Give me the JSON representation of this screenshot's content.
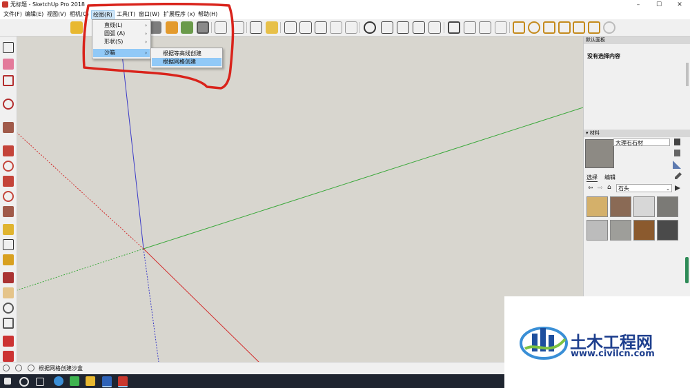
{
  "window": {
    "title": "无标题 - SketchUp Pro 2018",
    "controls": [
      "–",
      "☐",
      "✕"
    ]
  },
  "menubar": {
    "items": [
      {
        "label": "文件(F)"
      },
      {
        "label": "编辑(E)"
      },
      {
        "label": "视图(V)"
      },
      {
        "label": "相机(C)"
      },
      {
        "label": "绘图(R)",
        "active": true
      },
      {
        "label": "工具(T)"
      },
      {
        "label": "窗口(W)"
      },
      {
        "label": "扩展程序 (x)"
      },
      {
        "label": "帮助(H)"
      }
    ]
  },
  "draw_menu": {
    "items": [
      {
        "label": "直线(L)"
      },
      {
        "label": "圆弧 (A)"
      },
      {
        "label": "形状(S)"
      },
      {
        "label": "沙箱",
        "highlighted": true
      }
    ]
  },
  "sandbox_submenu": {
    "items": [
      {
        "label": "根据等高线创建"
      },
      {
        "label": "根据网格创建",
        "highlighted": true
      }
    ]
  },
  "right_panel": {
    "title": "默认面板",
    "entity_info_label": "没有选择内容",
    "materials_header": "材料",
    "material_name": "大理石石材",
    "tabs": {
      "select": "选择",
      "edit": "编辑"
    },
    "library": "石头",
    "swatch_colors": [
      "#d4b06a",
      "#8a6a55",
      "#d7d7d7",
      "#7b7a76",
      "#bcbcbc",
      "#9e9e9a",
      "#8b5a2e",
      "#4a4a4a"
    ]
  },
  "statusbar": {
    "hint": "根据网格创建沙盒"
  },
  "watermark": {
    "brand": "土木工程网",
    "url": "www.civilcn.com"
  },
  "colors": {
    "annotation": "#d9231b",
    "axis_red": "#d22a2a",
    "axis_green": "#3aa83a",
    "axis_blue": "#3a3ac8"
  }
}
